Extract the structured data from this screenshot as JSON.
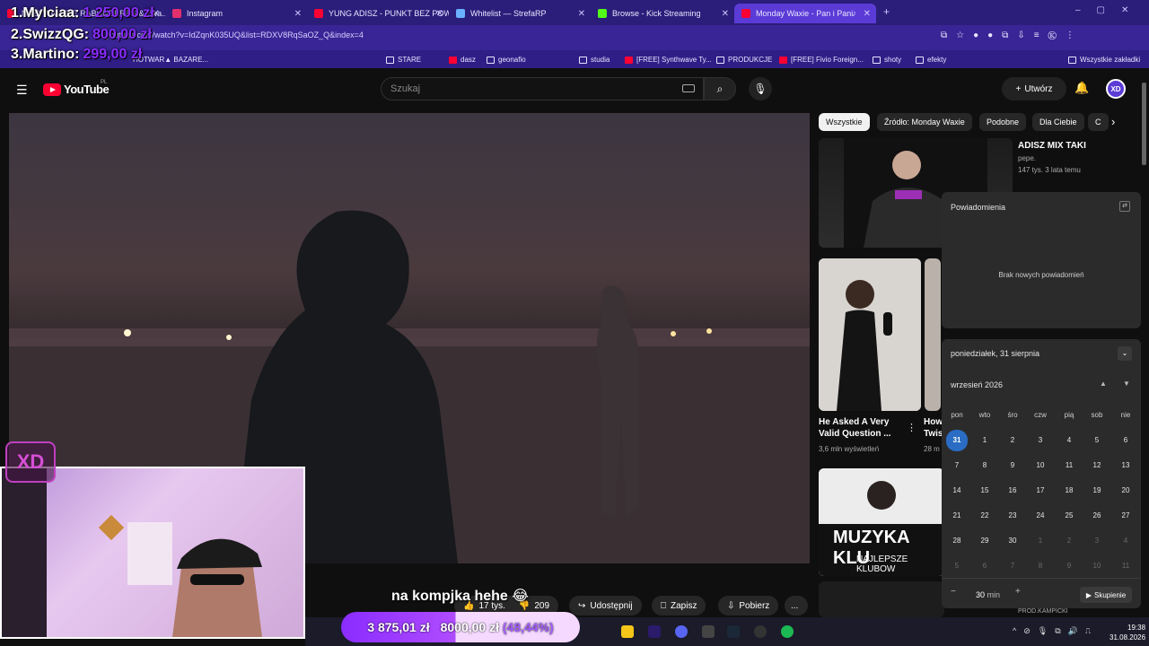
{
  "browser": {
    "tabs": [
      {
        "title": "NAZYWAM SIĘ RABUNDERRS & Zwa...",
        "color": "#ff0033"
      },
      {
        "title": "Instagram",
        "color": "#e1306c"
      },
      {
        "title": "YUNG ADISZ - PUNKT BEZ POW...",
        "color": "#ff0033"
      },
      {
        "title": "Whitelist — StrefaRP",
        "color": "#6ab0ff"
      },
      {
        "title": "Browse - Kick Streaming",
        "color": "#53fc18"
      },
      {
        "title": "Monday Waxie - Pan i Pani",
        "color": "#ff0033"
      }
    ],
    "url": "youtube.com/watch?v=IdZqnK035UQ&list=RDXV8RqSaOZ_Q&index=4",
    "bookmarks": [
      "HOTWAR▲ BAZARE...",
      "STARE",
      "dasz",
      "geonafio",
      "studia",
      "[FREE] Synthwave Ty...",
      "PRODUKCJE",
      "[FREE] Fivio Foreign...",
      "shoty",
      "efekty"
    ],
    "all_bookmarks": "Wszystkie zakładki"
  },
  "youtube": {
    "logo": "YouTube",
    "logo_region": "PL",
    "search_placeholder": "Szukaj",
    "create_label": "Utwórz",
    "avatar_text": "XD",
    "chips": [
      "Wszystkie",
      "Źródło: Monday Waxie",
      "Podobne",
      "Dla Ciebie",
      "C"
    ],
    "recs": [
      {
        "title": "ADISZ MIX TAKI",
        "channel": "pepe.",
        "meta": "147 tys.   3 lata temu"
      },
      {
        "title": "He Asked A Very Valid Question ...",
        "meta": "3,6 mln wyświetleń"
      },
      {
        "title": "How Twis",
        "meta": "28 m"
      },
      {
        "title": "MUZYKA KLU",
        "subtitle": "NAJLEPSZE KLUBOW",
        "meta": "PROD.KAMPICKI"
      }
    ],
    "actions": {
      "likes": "17 tys.",
      "dislikes": "209",
      "share": "Udostępnij",
      "save": "Zapisz",
      "download": "Pobierz",
      "more": "..."
    }
  },
  "notifications": {
    "title": "Powiadomienia",
    "empty": "Brak nowych powiadomień"
  },
  "calendar": {
    "date_label": "poniedziałek, 31 sierpnia",
    "month_label": "wrzesień 2026",
    "weekdays": [
      "pon",
      "wto",
      "śro",
      "czw",
      "pią",
      "sob",
      "nie"
    ],
    "weeks": [
      [
        "31",
        "1",
        "2",
        "3",
        "4",
        "5",
        "6"
      ],
      [
        "7",
        "8",
        "9",
        "10",
        "11",
        "12",
        "13"
      ],
      [
        "14",
        "15",
        "16",
        "17",
        "18",
        "19",
        "20"
      ],
      [
        "21",
        "22",
        "23",
        "24",
        "25",
        "26",
        "27"
      ],
      [
        "28",
        "29",
        "30",
        "1",
        "2",
        "3",
        "4"
      ],
      [
        "5",
        "6",
        "7",
        "8",
        "9",
        "10",
        "11"
      ]
    ],
    "focus_minutes": "30",
    "focus_unit": "min",
    "focus_label": "Skupienie",
    "minus": "−",
    "plus": "+"
  },
  "overlay": {
    "ranking": [
      {
        "name": "1.Mylciaa:",
        "amount": "1 250,00 zł"
      },
      {
        "name": "2.SwizzQG:",
        "amount": "800,00 zł"
      },
      {
        "name": "3.Martino:",
        "amount": "299,00 zł"
      }
    ],
    "caption": "na kompjka hehe 😂",
    "donation": {
      "current": "3 875,01 zł",
      "goal": "8000,00 zł",
      "percent": "(48,44%)",
      "progress": 0.4844
    },
    "logo": "XD"
  },
  "taskbar": {
    "time": "19:38",
    "date": "31.08.2026"
  },
  "colors": {
    "accent": "#8a2cff",
    "yt_red": "#ff0033",
    "calendar_today": "#2b6cc4"
  }
}
